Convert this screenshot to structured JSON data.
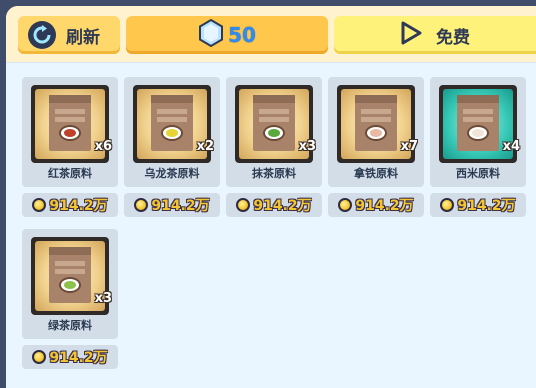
{
  "toolbar": {
    "refresh_label": "刷新",
    "gem_count": "50",
    "free_label": "免费"
  },
  "items": [
    {
      "name": "红茶原料",
      "qty": "x6",
      "price": "914.2万",
      "liquid": "#c0412a",
      "bg": "gold"
    },
    {
      "name": "乌龙茶原料",
      "qty": "x2",
      "price": "914.2万",
      "liquid": "#e8d335",
      "bg": "gold"
    },
    {
      "name": "抹茶原料",
      "qty": "x3",
      "price": "914.2万",
      "liquid": "#5aa83b",
      "bg": "gold"
    },
    {
      "name": "拿铁原料",
      "qty": "x7",
      "price": "914.2万",
      "liquid": "#e9b9a3",
      "bg": "gold"
    },
    {
      "name": "西米原料",
      "qty": "x4",
      "price": "914.2万",
      "liquid": "#f0e6d6",
      "bg": "teal"
    },
    {
      "name": "绿茶原料",
      "qty": "x3",
      "price": "914.2万",
      "liquid": "#8dc24a",
      "bg": "gold"
    }
  ],
  "colors": {
    "gem": "#9fd3ff",
    "coin": "#f3c530",
    "accent": "#ffc84c"
  },
  "icons": {
    "refresh": "refresh-icon",
    "gem": "gem-icon",
    "play": "play-icon",
    "coin": "coin-icon"
  }
}
